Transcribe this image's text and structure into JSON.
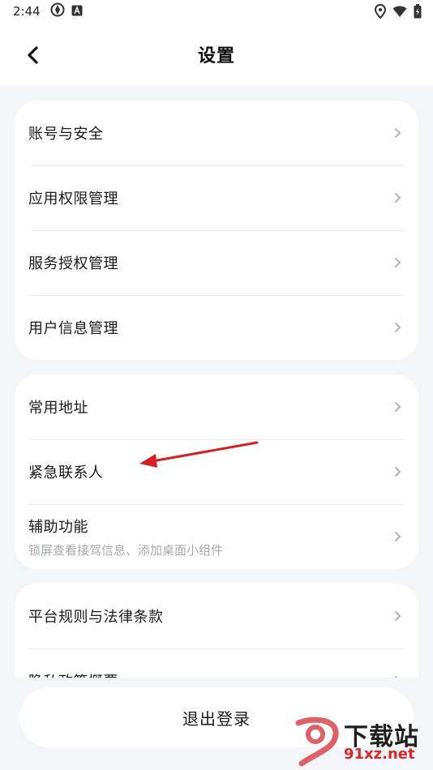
{
  "status_bar": {
    "time": "2:44"
  },
  "header": {
    "title": "设置"
  },
  "groups": [
    {
      "items": [
        {
          "label": "账号与安全"
        },
        {
          "label": "应用权限管理"
        },
        {
          "label": "服务授权管理"
        },
        {
          "label": "用户信息管理"
        }
      ]
    },
    {
      "items": [
        {
          "label": "常用地址"
        },
        {
          "label": "紧急联系人"
        },
        {
          "label": "辅助功能",
          "sublabel": "锁屏查看接驾信息、添加桌面小组件"
        }
      ]
    },
    {
      "items": [
        {
          "label": "平台规则与法律条款"
        },
        {
          "label": "隐私政策概要"
        }
      ]
    }
  ],
  "logout": {
    "label": "退出登录"
  },
  "watermark": {
    "brand": "下载站",
    "domain": "91xz.net"
  },
  "colors": {
    "background": "#f4f5f9",
    "card": "#ffffff",
    "annotation_arrow": "#d42020",
    "watermark_red": "#d9262a"
  }
}
